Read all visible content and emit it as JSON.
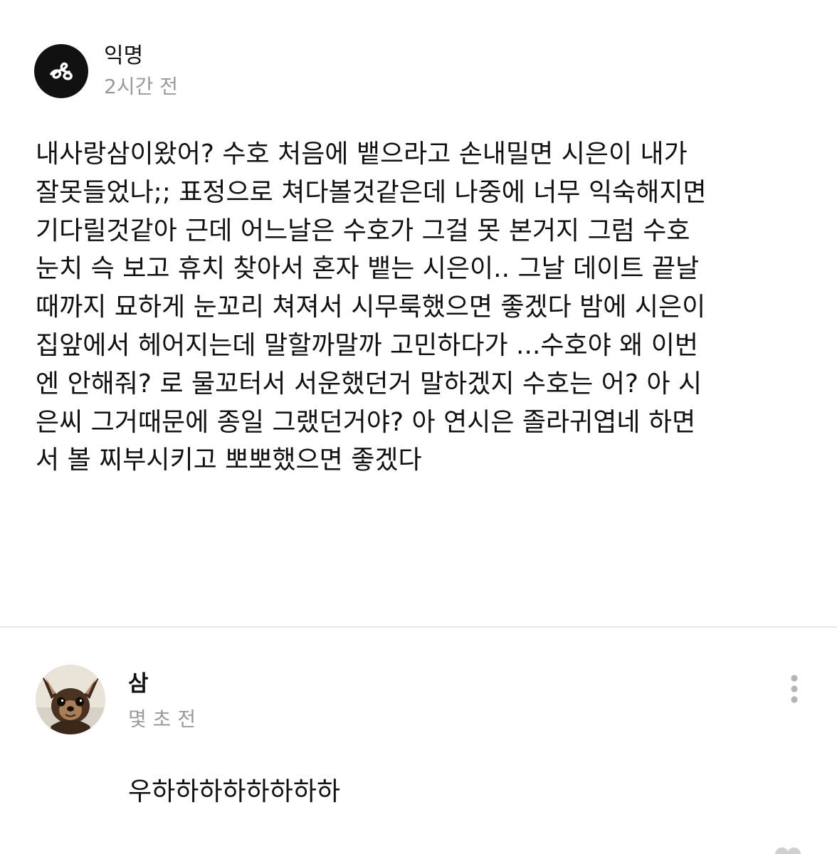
{
  "post": {
    "author": "익명",
    "time": "2시간 전",
    "lines": [
      "내사랑삼이왔어? 수호 처음에 뱉으라고 손내밀면 시은이 내가",
      "잘못들었나;; 표정으로 쳐다볼것같은데 나중에 너무 익숙해지면",
      "기다릴것같아 근데 어느날은 수호가 그걸 못 본거지 그럼 수호",
      "눈치 슥 보고 휴치 찾아서 혼자 뱉는 시은이.. 그날 데이트 끝날",
      "때까지 묘하게 눈꼬리 쳐져서 시무룩했으면 좋겠다 밤에 시은이",
      "집앞에서 헤어지는데 말할까말까 고민하다가 ...수호야 왜 이번",
      "엔 안해줘? 로 물꼬터서 서운했던거 말하겠지 수호는 어? 아 시",
      "은씨 그거때문에 종일 그랬던거야? 아 연시은 졸라귀엽네 하면",
      "서 볼 찌부시키고 뽀뽀했으면 좋겠다"
    ]
  },
  "comment": {
    "author": "삼",
    "time": "몇 초 전",
    "text": "우하하하하하하하하"
  },
  "icons": {
    "anon_avatar": "anonymous-logo-icon",
    "comment_avatar": "chihuahua-photo-avatar",
    "more": "vertical-ellipsis-icon",
    "corner": "heart-icon"
  }
}
